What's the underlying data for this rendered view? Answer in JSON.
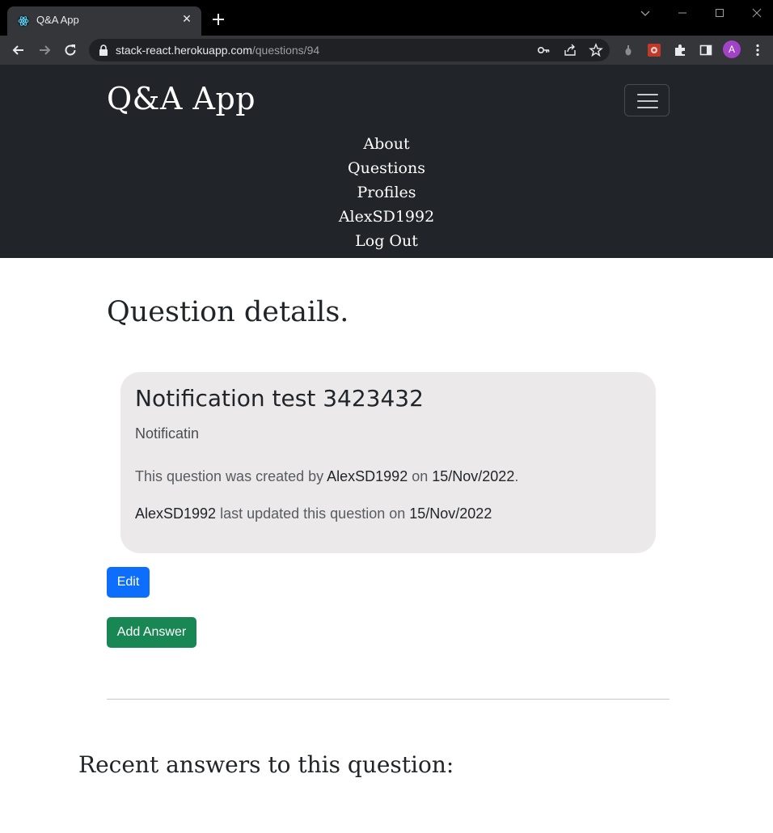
{
  "browser": {
    "tab_title": "Q&A App",
    "url_host": "stack-react.herokuapp.com",
    "url_path": "/questions/94",
    "profile_initial": "A"
  },
  "navbar": {
    "brand": "Q&A App",
    "links": [
      "About",
      "Questions",
      "Profiles",
      "AlexSD1992",
      "Log Out"
    ]
  },
  "page": {
    "title": "Question details."
  },
  "question": {
    "title": "Notification test 3423432",
    "body": "Notificatin",
    "created_prefix": "This question was created by ",
    "created_by": "AlexSD1992",
    "created_on_word": " on ",
    "created_date": "15/Nov/2022",
    "created_suffix": ".",
    "updated_by": "AlexSD1992",
    "updated_text": " last updated this question on ",
    "updated_date": "15/Nov/2022"
  },
  "actions": {
    "edit_label": "Edit",
    "add_answer_label": "Add Answer"
  },
  "answers": {
    "heading": "Recent answers to this question:"
  },
  "colors": {
    "navbar_bg": "#212529",
    "card_bg": "#ebe9ea",
    "edit_btn": "#0d6efd",
    "answer_btn": "#198754"
  }
}
